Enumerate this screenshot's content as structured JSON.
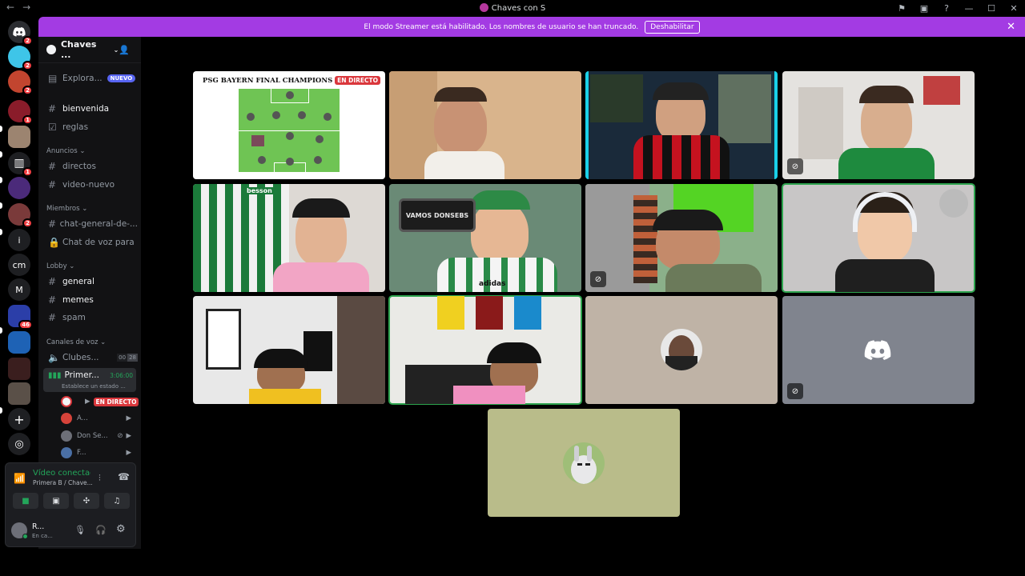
{
  "window": {
    "title": "Chaves con S",
    "nav_back": "←",
    "nav_forward": "→",
    "controls": [
      "⚑",
      "▣",
      "?",
      "—",
      "☐",
      "✕"
    ]
  },
  "banner": {
    "text": "El modo Streamer está habilitado. Los nombres de usuario se han truncado.",
    "button": "Deshabilitar"
  },
  "rail": {
    "badges": [
      "2",
      "2",
      "2",
      "1",
      "1",
      "2",
      "46"
    ],
    "letters": [
      "i",
      "cm",
      "M"
    ]
  },
  "server": {
    "name": "Chaves ...",
    "explore": "Explora...",
    "new_badge": "NUEVO"
  },
  "channels": {
    "top": [
      {
        "label": "bienvenida"
      },
      {
        "label": "reglas"
      }
    ],
    "cat_anuncios": "Anuncios",
    "anuncios": [
      {
        "label": "directos"
      },
      {
        "label": "video-nuevo"
      }
    ],
    "cat_miembros": "Miembros",
    "miembros": [
      {
        "label": "chat-general-de-..."
      },
      {
        "label": "Chat de voz para ..."
      }
    ],
    "cat_lobby": "Lobby",
    "lobby": [
      {
        "label": "general"
      },
      {
        "label": "memes"
      },
      {
        "label": "spam"
      }
    ],
    "cat_voz": "Canales de voz",
    "voice1": {
      "label": "Clubes...",
      "count_a": "00",
      "count_b": "28"
    },
    "voice2": {
      "label": "Primer...",
      "timer": "3:06:00",
      "status": "Establece un estado ..."
    },
    "voice_users": [
      {
        "name": "",
        "live": "EN DIRECTO"
      },
      {
        "name": "A..."
      },
      {
        "name": "Don Se..."
      },
      {
        "name": "F..."
      }
    ]
  },
  "voice_panel": {
    "status": "Vídeo conectad",
    "channel": "Primera B / Chave..."
  },
  "user": {
    "name": "R...",
    "status": "En ca..."
  },
  "stream_tile": {
    "title": "PSG BAYERN FINAL CHAMPIONS L",
    "live": "EN DIRECTO"
  },
  "phone_text": "VAMOS DONSEBS",
  "shirt_text": "adidas",
  "banner_text": "besson",
  "colors": {
    "accent": "#a33be3",
    "speaking": "#2da44e",
    "live": "#da373c",
    "blurple": "#5865f2"
  }
}
